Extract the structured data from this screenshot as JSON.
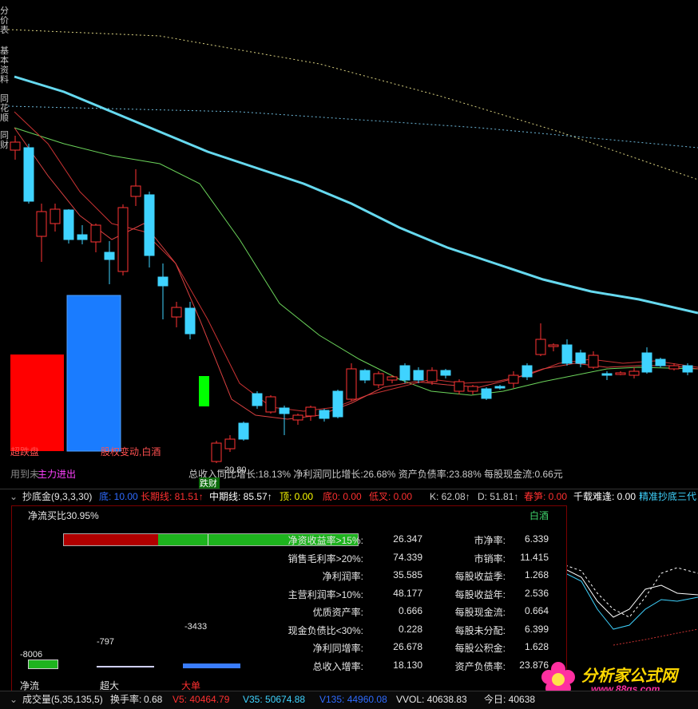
{
  "side_tabs": [
    "分价表",
    "基本资料",
    "同花顺",
    "同财"
  ],
  "chart": {
    "price_low_label": "←20.80",
    "buy_label": "用到未",
    "buy_label2": "主力进出",
    "bottom_left_label": "超跌盘",
    "event_label": "股权变动,白酒",
    "overlay_stats": "总收入同比增长:18.13% 净利润同比增长:26.68% 资产负债率:23.88% 每股现金流:0.66元",
    "fall_label": "跌财"
  },
  "indicator_bar": {
    "toggle": "⌄",
    "name": "抄底金(9,3,3,30)",
    "items": [
      {
        "label": "底:",
        "value": "10.00",
        "color": "#2f6bff"
      },
      {
        "label": "长期线:",
        "value": "81.51",
        "arrow": "↑",
        "color": "#ff3030"
      },
      {
        "label": "中期线:",
        "value": "85.57",
        "arrow": "↑",
        "color": "#ffffff"
      },
      {
        "label": "顶:",
        "value": "0.00",
        "color": "#ffff00"
      },
      {
        "label": "底0:",
        "value": "0.00",
        "color": "#ff3030"
      },
      {
        "label": "低叉:",
        "value": "0.00",
        "color": "#ff3030"
      },
      {
        "label": "K:",
        "value": "62.08",
        "arrow": "↑",
        "color": "#cccccc"
      },
      {
        "label": "D:",
        "value": "51.81",
        "arrow": "↑",
        "color": "#cccccc"
      },
      {
        "label": "春笋:",
        "value": "0.00",
        "color": "#ff3030"
      },
      {
        "label": "千载难逢:",
        "value": "0.00",
        "color": "#ffffff"
      },
      {
        "label": "精准抄底三代",
        "value": "",
        "color": "#3fd3ff"
      }
    ]
  },
  "panel": {
    "net_flow": "净流买比30.95%",
    "sector": "白酒",
    "flow_bar": {
      "red_fraction": 0.32,
      "green_fraction": 0.68
    },
    "left_metrics": [
      {
        "label": "净资收益率>15%:",
        "value": "26.347"
      },
      {
        "label": "销售毛利率>20%:",
        "value": "74.339"
      },
      {
        "label": "净利润率:",
        "value": "35.585"
      },
      {
        "label": "主营利润率>10%:",
        "value": "48.177"
      },
      {
        "label": "优质资产率:",
        "value": "0.666"
      },
      {
        "label": "现金负债比<30%:",
        "value": "0.228"
      },
      {
        "label": "净利同增率:",
        "value": "26.678"
      },
      {
        "label": "总收入增率:",
        "value": "18.130"
      }
    ],
    "right_metrics": [
      {
        "label": "市净率:",
        "value": "6.339"
      },
      {
        "label": "市销率:",
        "value": "11.415"
      },
      {
        "label": "每股收益季:",
        "value": "1.268"
      },
      {
        "label": "每股收益年:",
        "value": "2.536"
      },
      {
        "label": "每股现金流:",
        "value": "0.664"
      },
      {
        "label": "每股未分配:",
        "value": "6.399"
      },
      {
        "label": "每股公积金:",
        "value": "1.628"
      },
      {
        "label": "资产负债率:",
        "value": "23.876"
      }
    ],
    "flow_values": {
      "net": "-8006",
      "super": "-797",
      "big": "-3433"
    },
    "flow_labels": {
      "net": "净流",
      "super": "超大",
      "big": "大单"
    }
  },
  "bottom_bar": {
    "toggle": "⌄",
    "name": "成交量(5,35,135,5)",
    "turnover_label": "换手率:",
    "turnover": "0.68",
    "v5": "V5: 40464.79",
    "v35": "V35: 50674.88",
    "v135": "V135: 44960.08",
    "vvol": "VVOL: 40638.83",
    "today": "今日: 40638"
  },
  "watermark": {
    "title": "分析家公式网",
    "url": "www.88gs.com"
  },
  "colors": {
    "up": "#ff3333",
    "down": "#3fd3ff",
    "ma_long": "#66d9ef",
    "ma_green": "#6bd35a",
    "ma_red": "#c83232"
  }
}
